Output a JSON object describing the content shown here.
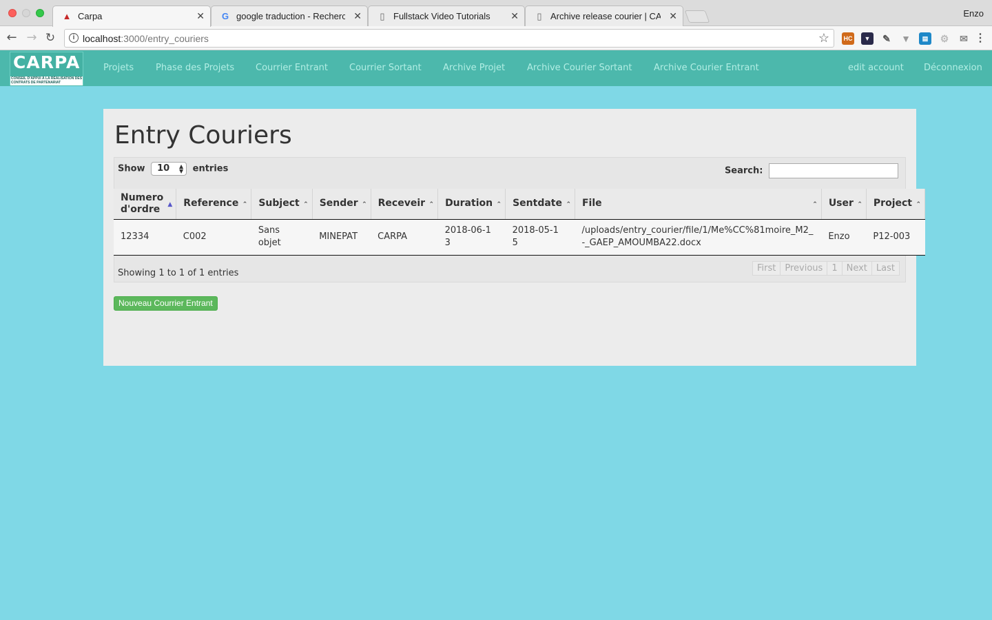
{
  "browser": {
    "tabs": [
      {
        "title": "Carpa",
        "icon": "warning-icon"
      },
      {
        "title": "google traduction - Recherche",
        "icon": "google-icon"
      },
      {
        "title": "Fullstack Video Tutorials",
        "icon": "document-icon"
      },
      {
        "title": "Archive release courier | CARPA",
        "icon": "document-icon"
      }
    ],
    "profile": "Enzo",
    "url_host": "localhost",
    "url_path": ":3000/entry_couriers"
  },
  "site": {
    "logo_text": "CARPA",
    "logo_subtitle": "CONSEIL D'APPUI À LA RÉALISATION DES CONTRATS DE PARTENARIAT",
    "nav": [
      "Projets",
      "Phase des Projets",
      "Courrier Entrant",
      "Courrier Sortant",
      "Archive Projet",
      "Archive Courier Sortant",
      "Archive Courier Entrant"
    ],
    "right_nav": [
      "edit account",
      "Déconnexion"
    ]
  },
  "page": {
    "title": "Entry Couriers",
    "show_label": "Show",
    "entries_value": "10",
    "entries_label": "entries",
    "search_label": "Search:",
    "search_value": "",
    "columns": [
      "Numero d'ordre",
      "Reference",
      "Subject",
      "Sender",
      "Receveir",
      "Duration",
      "Sentdate",
      "File",
      "User",
      "Project"
    ],
    "rows": [
      {
        "numero": "12334",
        "reference": "C002",
        "subject": "Sans objet",
        "sender": "MINEPAT",
        "receveir": "CARPA",
        "duration": "2018-06-13",
        "sentdate": "2018-05-15",
        "file": "/uploads/entry_courier/file/1/Me%CC%81moire_M2_-_GAEP_AMOUMBA22.docx",
        "user": "Enzo",
        "project": "P12-003"
      }
    ],
    "info": "Showing 1 to 1 of 1 entries",
    "paging": [
      "First",
      "Previous",
      "1",
      "Next",
      "Last"
    ],
    "new_button": "Nouveau Courrier Entrant"
  },
  "colors": {
    "page_bg": "#7fd8e6",
    "nav_bg": "#4cb8ac",
    "nav_link": "#b2eee4",
    "button_green": "#5cb85c"
  }
}
